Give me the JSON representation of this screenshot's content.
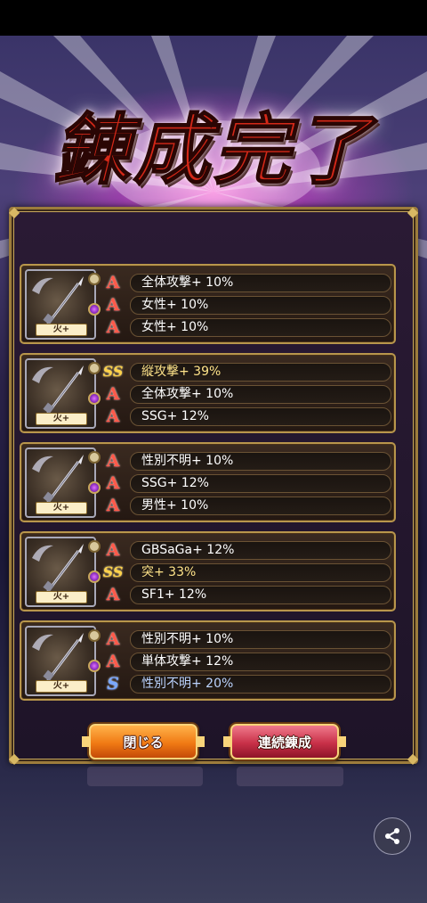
{
  "title": "錬成完了",
  "cards": [
    {
      "element_label": "火+",
      "stats": [
        {
          "rank": "A",
          "text": "全体攻撃+ 10%",
          "style": ""
        },
        {
          "rank": "A",
          "text": "女性+ 10%",
          "style": ""
        },
        {
          "rank": "A",
          "text": "女性+ 10%",
          "style": ""
        }
      ]
    },
    {
      "element_label": "火+",
      "stats": [
        {
          "rank": "SS",
          "text": "縦攻撃+ 39%",
          "style": "hl-gold"
        },
        {
          "rank": "A",
          "text": "全体攻撃+ 10%",
          "style": ""
        },
        {
          "rank": "A",
          "text": "SSG+ 12%",
          "style": ""
        }
      ]
    },
    {
      "element_label": "火+",
      "stats": [
        {
          "rank": "A",
          "text": "性別不明+ 10%",
          "style": ""
        },
        {
          "rank": "A",
          "text": "SSG+ 12%",
          "style": ""
        },
        {
          "rank": "A",
          "text": "男性+ 10%",
          "style": ""
        }
      ]
    },
    {
      "element_label": "火+",
      "stats": [
        {
          "rank": "A",
          "text": "GBSaGa+ 12%",
          "style": ""
        },
        {
          "rank": "SS",
          "text": "突+ 33%",
          "style": "hl-gold"
        },
        {
          "rank": "A",
          "text": "SF1+ 12%",
          "style": ""
        }
      ]
    },
    {
      "element_label": "火+",
      "stats": [
        {
          "rank": "A",
          "text": "性別不明+ 10%",
          "style": ""
        },
        {
          "rank": "A",
          "text": "単体攻撃+ 12%",
          "style": ""
        },
        {
          "rank": "S",
          "text": "性別不明+ 20%",
          "style": "hl-blue"
        }
      ]
    }
  ],
  "buttons": {
    "close_label": "閉じる",
    "repeat_label": "連続錬成"
  },
  "icons": {
    "share": "share-icon",
    "weapon": "spear-icon"
  },
  "colors": {
    "rank_A": "#ff5a4a",
    "rank_SS": "#ffd24a",
    "rank_S": "#7aa8ff",
    "frame_gold": "#b8964c"
  }
}
